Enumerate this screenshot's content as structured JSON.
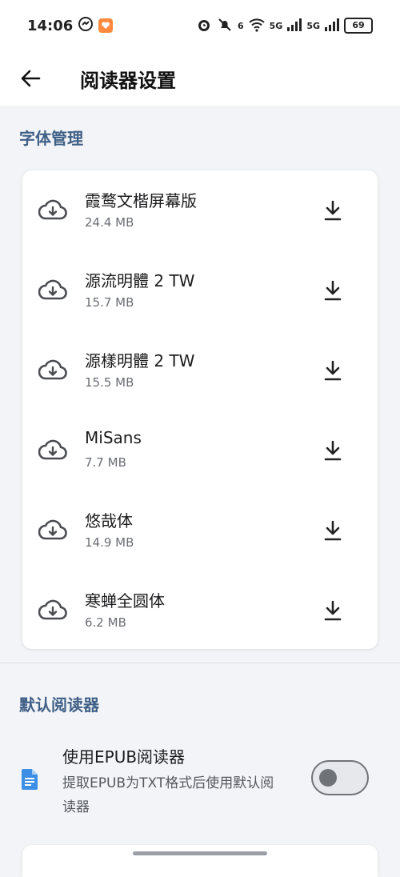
{
  "status_bar": {
    "time": "14:06",
    "battery": "69",
    "net_5g_1": "5G",
    "net_5g_2": "5G",
    "net_6": "6"
  },
  "app_bar": {
    "title": "阅读器设置"
  },
  "font_section": {
    "title": "字体管理",
    "items": [
      {
        "name": "霞鹜文楷屏幕版",
        "size": "24.4 MB"
      },
      {
        "name": "源流明體 2 TW",
        "size": "15.7 MB"
      },
      {
        "name": "源樣明體 2 TW",
        "size": "15.5 MB"
      },
      {
        "name": "MiSans",
        "size": "7.7 MB"
      },
      {
        "name": "悠哉体",
        "size": "14.9 MB"
      },
      {
        "name": "寒蝉全圆体",
        "size": "6.2 MB"
      }
    ]
  },
  "reader_section": {
    "title": "默认阅读器",
    "epub_title": "使用EPUB阅读器",
    "epub_desc": "提取EPUB为TXT格式后使用默认阅读器",
    "epub_enabled": false
  },
  "colors": {
    "accent": "#3f5f86",
    "doc_icon": "#3d8fe6",
    "background": "#f2f4f7"
  },
  "icons": {
    "back": "arrow-left-icon",
    "font_cloud": "cloud-download-icon",
    "download": "download-icon",
    "epub": "document-icon"
  }
}
